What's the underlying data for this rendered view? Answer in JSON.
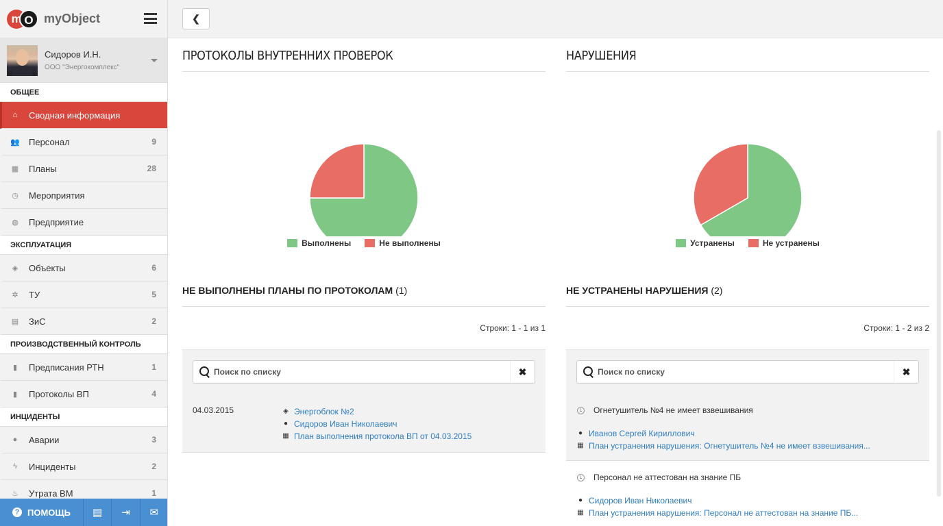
{
  "brand": {
    "logo_m": "m",
    "logo_o": "O",
    "name": "myObject"
  },
  "user": {
    "name": "Сидоров И.Н.",
    "org": "ООО \"Энергокомплекс\""
  },
  "sidebar": {
    "sections": [
      {
        "title": "ОБЩЕЕ",
        "items": [
          {
            "label": "Сводная информация",
            "count": "",
            "icon": "home-icon",
            "glyph": "⌂",
            "active": true
          },
          {
            "label": "Персонал",
            "count": "9",
            "icon": "users-icon",
            "glyph": "👥"
          },
          {
            "label": "Планы",
            "count": "28",
            "icon": "calendar-icon",
            "glyph": "▦"
          },
          {
            "label": "Мероприятия",
            "count": "",
            "icon": "clock-icon",
            "glyph": "◷"
          },
          {
            "label": "Предприятие",
            "count": "",
            "icon": "globe-icon",
            "glyph": "◍"
          }
        ]
      },
      {
        "title": "ЭКСПЛУАТАЦИЯ",
        "items": [
          {
            "label": "Объекты",
            "count": "6",
            "icon": "cube-icon",
            "glyph": "◈"
          },
          {
            "label": "ТУ",
            "count": "5",
            "icon": "gear-icon",
            "glyph": "✲"
          },
          {
            "label": "ЗиС",
            "count": "2",
            "icon": "building-icon",
            "glyph": "▤"
          }
        ]
      },
      {
        "title": "ПРОИЗВОДСТВЕННЫЙ КОНТРОЛЬ",
        "items": [
          {
            "label": "Предписания РТН",
            "count": "1",
            "icon": "file-icon",
            "glyph": "▮"
          },
          {
            "label": "Протоколы ВП",
            "count": "4",
            "icon": "file-icon",
            "glyph": "▮"
          }
        ]
      },
      {
        "title": "ИНЦИДЕНТЫ",
        "items": [
          {
            "label": "Аварии",
            "count": "3",
            "icon": "bomb-icon",
            "glyph": "●"
          },
          {
            "label": "Инциденты",
            "count": "2",
            "icon": "bolt-icon",
            "glyph": "ϟ"
          },
          {
            "label": "Утрата ВМ",
            "count": "1",
            "icon": "fire-icon",
            "glyph": "♨"
          }
        ]
      }
    ]
  },
  "bottom_bar": {
    "help_q": "?",
    "help_label": "ПОМОЩЬ",
    "book_glyph": "▤",
    "login_glyph": "⇥",
    "mail_glyph": "✉"
  },
  "topbar": {
    "back_glyph": "❮"
  },
  "colors": {
    "green": "#7ec785",
    "red": "#e86e65",
    "accent": "#d9463b",
    "link": "#2f7dc2"
  },
  "left_panel": {
    "title": "ПРОТОКОЛЫ ВНУТРЕННИХ ПРОВЕРОК",
    "list_title": "НЕ ВЫПОЛНЕНЫ ПЛАНЫ ПО ПРОТОКОЛАМ",
    "list_count": "(1)",
    "rows_info": "Строки: 1 - 1 из 1",
    "search_placeholder": "Поиск по списку",
    "clear_glyph": "✖",
    "rows": [
      {
        "date": "04.03.2015",
        "object": "Энергоблок №2",
        "person": "Сидоров Иван Николаевич",
        "plan": "План выполнения протокола ВП от 04.03.2015"
      }
    ]
  },
  "right_panel": {
    "title": "НАРУШЕНИЯ",
    "list_title": "НЕ УСТРАНЕНЫ НАРУШЕНИЯ",
    "list_count": "(2)",
    "rows_info": "Строки: 1 - 2 из 2",
    "search_placeholder": "Поиск по списку",
    "clear_glyph": "✖",
    "rows": [
      {
        "title": "Огнетушитель №4 не имеет взвешивания",
        "person": "Иванов Сергей Кириллович",
        "plan": "План устранения нарушения: Огнетушитель №4 не имеет взвешивания..."
      },
      {
        "title": "Персонал не аттестован на знание ПБ",
        "person": "Сидоров Иван Николаевич",
        "plan": "План устранения нарушения: Персонал не аттестован на знание ПБ..."
      }
    ]
  },
  "chart_data": [
    {
      "type": "pie",
      "title": "ПРОТОКОЛЫ ВНУТРЕННИХ ПРОВЕРОК",
      "categories": [
        "Выполнены",
        "Не выполнены"
      ],
      "values": [
        3,
        1
      ],
      "colors": [
        "#7ec785",
        "#e86e65"
      ],
      "legend": "bottom"
    },
    {
      "type": "pie",
      "title": "НАРУШЕНИЯ",
      "categories": [
        "Устранены",
        "Не устранены"
      ],
      "values": [
        4,
        2
      ],
      "colors": [
        "#7ec785",
        "#e86e65"
      ],
      "legend": "bottom"
    }
  ]
}
